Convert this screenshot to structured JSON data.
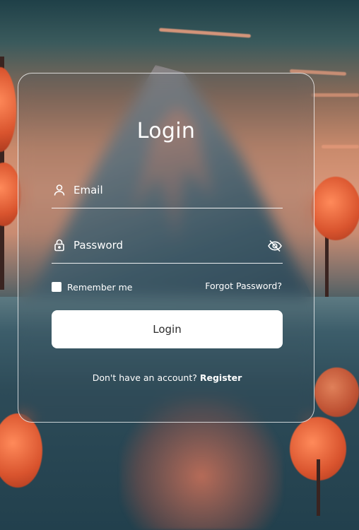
{
  "login_card": {
    "title": "Login",
    "email_field": {
      "placeholder": "Email",
      "icon": "user-icon"
    },
    "password_field": {
      "placeholder": "Password",
      "icon": "lock-icon",
      "toggle_icon": "eye-off-icon"
    },
    "remember_me": {
      "label": "Remember me",
      "checked": false
    },
    "forgot_password": "Forgot Password?",
    "submit_label": "Login",
    "register_prompt": "Don't have an account?",
    "register_link": "Register"
  },
  "colors": {
    "text": "#ffffff",
    "button_bg": "#ffffff",
    "button_text": "#2b2b2b",
    "card_border": "#ffffff",
    "accent_tree": "#d9542e"
  }
}
